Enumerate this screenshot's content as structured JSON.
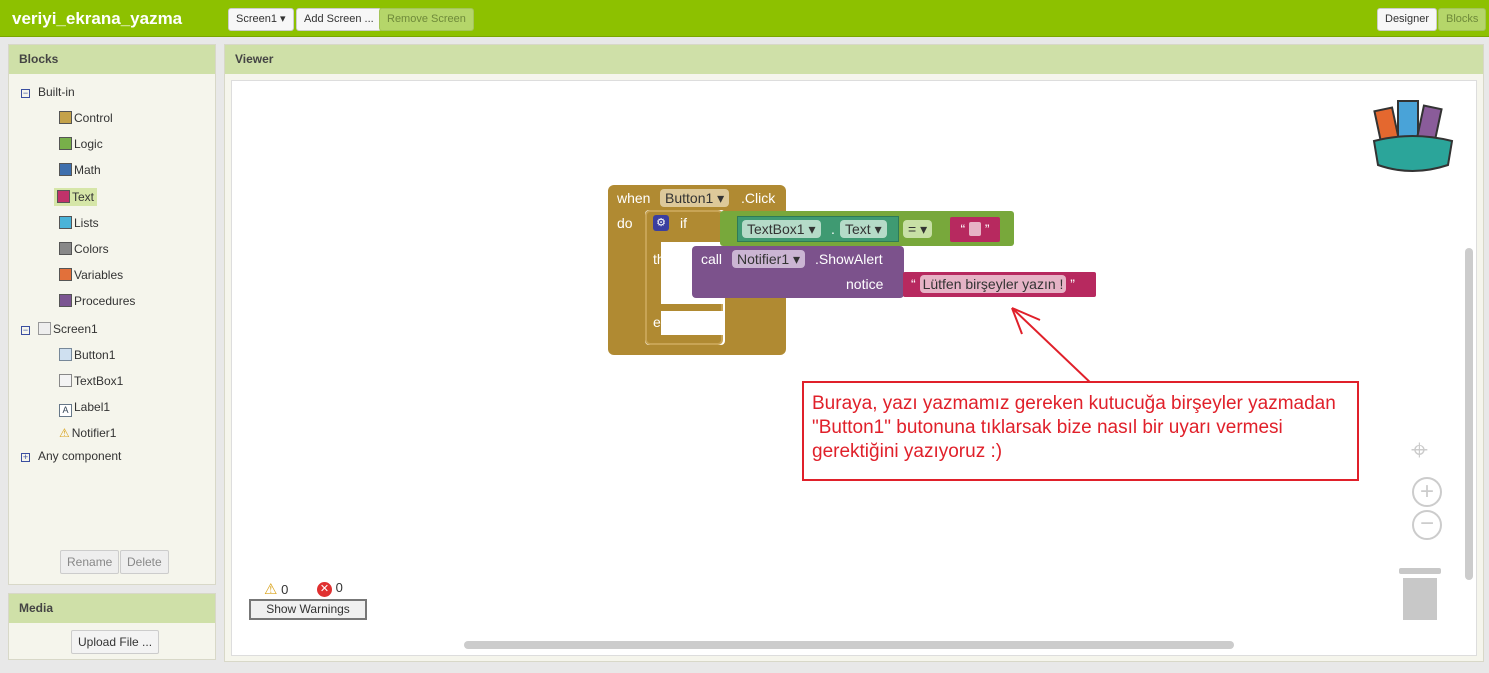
{
  "header": {
    "app_title": "veriyi_ekrana_yazma",
    "screen_select": "Screen1 ▾",
    "add_screen": "Add Screen ...",
    "remove_screen": "Remove Screen",
    "designer": "Designer",
    "blocks": "Blocks"
  },
  "blocks_panel": {
    "title": "Blocks",
    "builtin": "Built-in",
    "items": [
      {
        "label": "Control",
        "color": "#c4a24a"
      },
      {
        "label": "Logic",
        "color": "#78b04a"
      },
      {
        "label": "Math",
        "color": "#3e6fad"
      },
      {
        "label": "Text",
        "color": "#c0326a"
      },
      {
        "label": "Lists",
        "color": "#49b3d8"
      },
      {
        "label": "Colors",
        "color": "#888888"
      },
      {
        "label": "Variables",
        "color": "#e2703a"
      },
      {
        "label": "Procedures",
        "color": "#7b5592"
      }
    ],
    "screen": "Screen1",
    "components": [
      "Button1",
      "TextBox1",
      "Label1",
      "Notifier1"
    ],
    "any_component": "Any component",
    "rename": "Rename",
    "delete": "Delete"
  },
  "media_panel": {
    "title": "Media",
    "upload": "Upload File ..."
  },
  "viewer": {
    "title": "Viewer",
    "warnings_count": "0",
    "errors_count": "0",
    "show_warnings": "Show Warnings",
    "event": {
      "when": "when",
      "component": "Button1",
      "event": ".Click",
      "do": "do"
    },
    "if_block": {
      "if": "if",
      "then": "then",
      "else": "else"
    },
    "condition": {
      "component": "TextBox1",
      "dot": ".",
      "property": "Text",
      "op": "=",
      "empty_text": ""
    },
    "call": {
      "call": "call",
      "component": "Notifier1",
      "method": ".ShowAlert",
      "param": "notice",
      "value": "Lütfen birşeyler yazın !"
    },
    "annotation": "Buraya, yazı yazmamız gereken kutucuğa birşeyler yazmadan \"Button1\" butonuna tıklarsak bize nasıl bir uyarı vermesi gerektiğini yazıyoruz :)"
  }
}
